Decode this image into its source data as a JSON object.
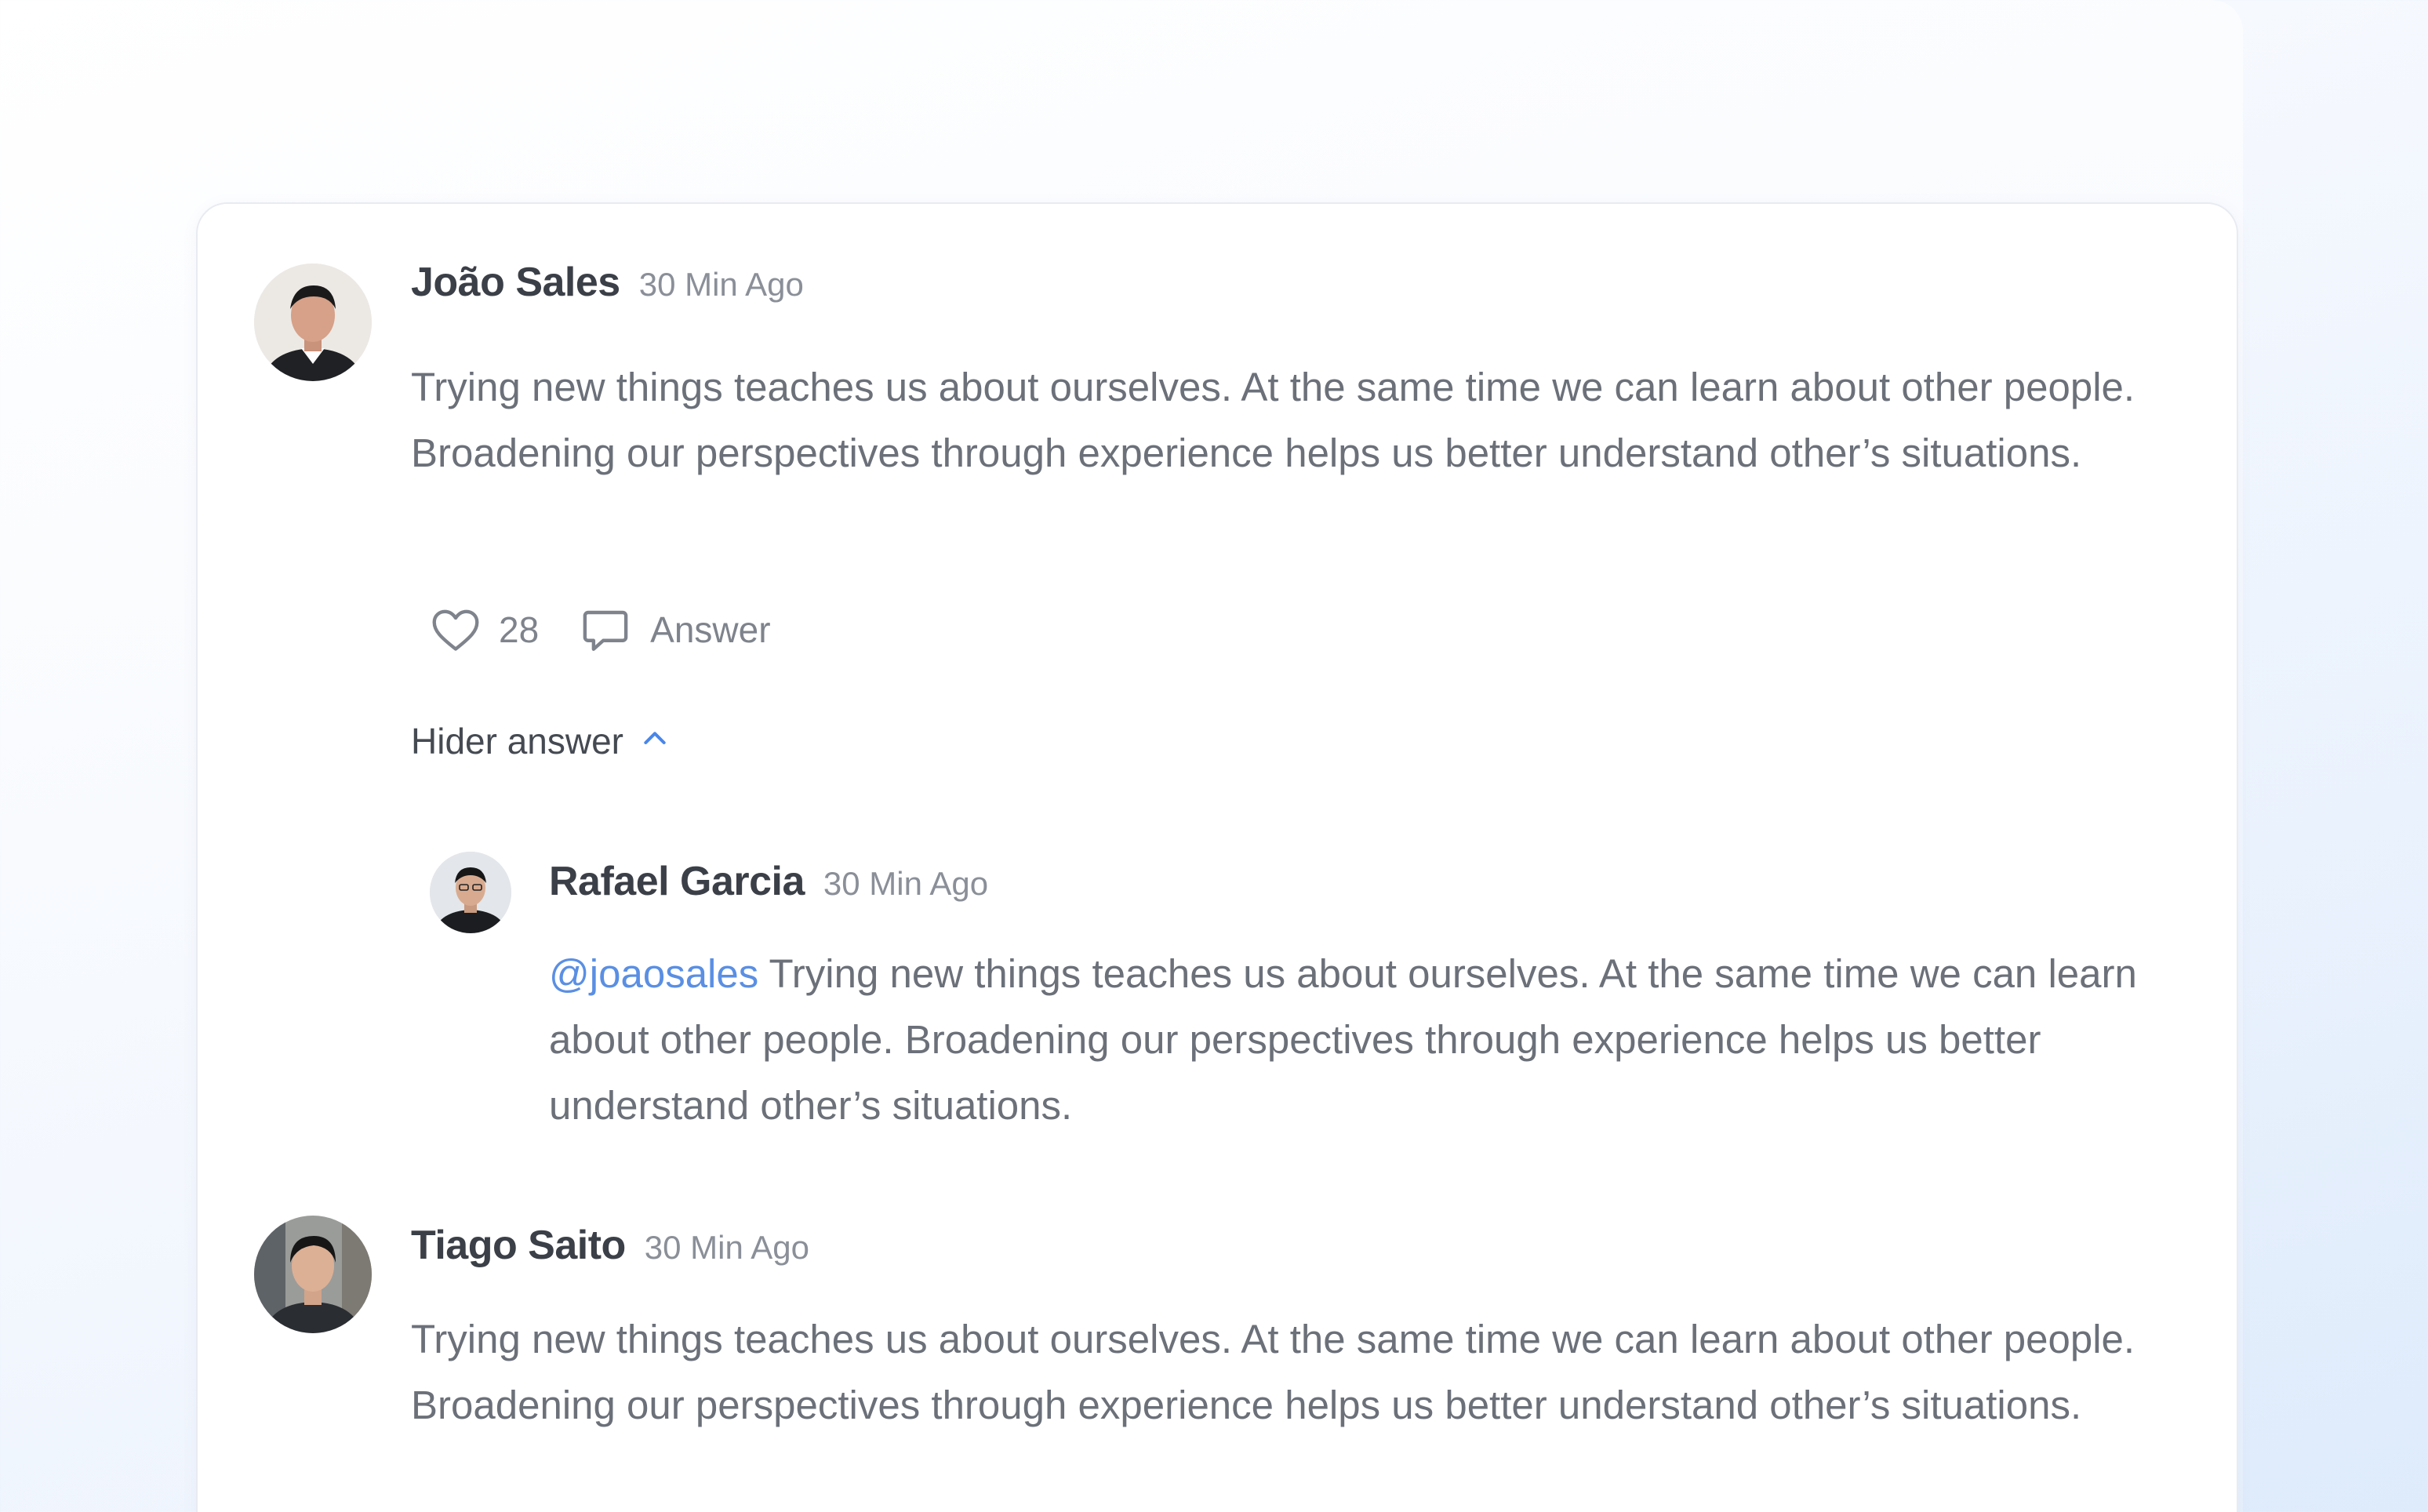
{
  "comments": [
    {
      "author": "João Sales",
      "time": "30 Min Ago",
      "text": "Trying new things teaches us about ourselves. At the same time we can learn about other people. Broadening our perspectives through experience helps us better understand other’s situations.",
      "likes": "28",
      "answer_label": "Answer",
      "toggle_label": "Hider answer",
      "avatar_icon": "person-avatar",
      "replies": [
        {
          "author": "Rafael Garcia",
          "time": "30 Min Ago",
          "mention": "@joaosales",
          "text": " Trying new things teaches us about ourselves. At the same time we can learn about other people. Broadening our perspectives through experience helps us better understand other’s situations.",
          "avatar_icon": "person-avatar"
        }
      ]
    },
    {
      "author": "Tiago Saito",
      "time": "30 Min Ago",
      "text": "Trying new things teaches us about ourselves. At the same time we can learn about other people. Broadening our perspectives through experience helps us better understand other’s situations.",
      "avatar_icon": "person-avatar"
    }
  ],
  "colors": {
    "mention": "#5a8fe3",
    "chevron": "#4a86e8",
    "name": "#3b3f47",
    "body": "#6b7079"
  },
  "icons": {
    "like": "heart-icon",
    "answer": "chat-bubble-icon",
    "toggle": "chevron-up-icon"
  }
}
